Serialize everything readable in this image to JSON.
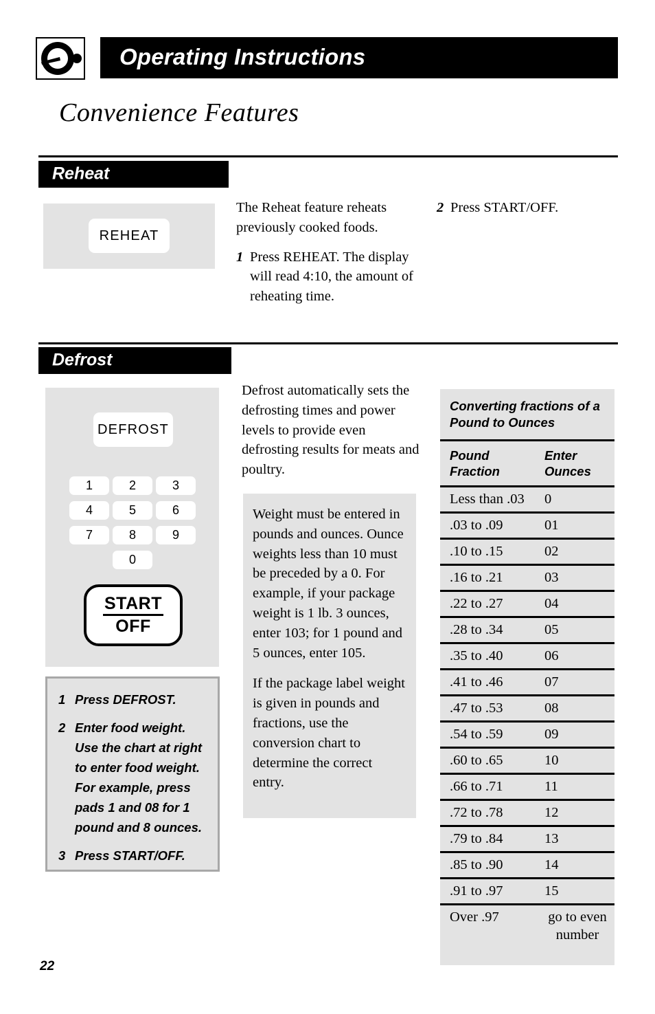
{
  "header": {
    "icon": "dial-knob-icon",
    "title": "Operating Instructions"
  },
  "page_title": "Convenience Features",
  "sections": {
    "reheat": {
      "bar_label": "Reheat",
      "panel": {
        "button_label": "REHEAT"
      },
      "intro": "The Reheat feature reheats previously cooked foods.",
      "steps": [
        {
          "num": "1",
          "text": "Press REHEAT. The display will read 4:10, the amount of reheating time."
        },
        {
          "num": "2",
          "text": "Press START/OFF."
        }
      ]
    },
    "defrost": {
      "bar_label": "Defrost",
      "panel": {
        "button_label": "DEFROST",
        "keypad": [
          "1",
          "2",
          "3",
          "4",
          "5",
          "6",
          "7",
          "8",
          "9",
          "0"
        ],
        "start_top": "START",
        "start_bottom": "OFF"
      },
      "intro": "Defrost automatically sets the defrosting times and power levels to provide even defrosting results for meats and poultry.",
      "note_paragraphs": [
        "Weight must be entered in pounds and ounces. Ounce weights less than 10 must be preceded by a 0. For example, if your package weight is 1 lb. 3 ounces, enter 103; for 1 pound and 5 ounces, enter 105.",
        "If the package label weight is given in pounds and fractions, use the conversion chart to determine the correct entry."
      ],
      "steps": [
        {
          "num": "1",
          "text": "Press DEFROST."
        },
        {
          "num": "2",
          "text": "Enter food weight. Use the chart at right to enter food weight. For example, press pads 1 and 08 for 1 pound and 8 ounces."
        },
        {
          "num": "3",
          "text": "Press START/OFF."
        }
      ]
    }
  },
  "conversion_table": {
    "title": "Converting fractions of a Pound to Ounces",
    "columns": [
      "Pound Fraction",
      "Enter Ounces"
    ],
    "column_head_left_line1": "Pound",
    "column_head_left_line2": "Fraction",
    "column_head_right_line1": "Enter",
    "column_head_right_line2": "Ounces",
    "rows": [
      {
        "fraction": "Less than .03",
        "ounces": "0"
      },
      {
        "fraction": ".03 to .09",
        "ounces": "01"
      },
      {
        "fraction": ".10 to .15",
        "ounces": "02"
      },
      {
        "fraction": ".16 to .21",
        "ounces": "03"
      },
      {
        "fraction": ".22 to .27",
        "ounces": "04"
      },
      {
        "fraction": ".28 to .34",
        "ounces": "05"
      },
      {
        "fraction": ".35 to .40",
        "ounces": "06"
      },
      {
        "fraction": ".41 to .46",
        "ounces": "07"
      },
      {
        "fraction": ".47 to .53",
        "ounces": "08"
      },
      {
        "fraction": ".54 to .59",
        "ounces": "09"
      },
      {
        "fraction": ".60 to .65",
        "ounces": "10"
      },
      {
        "fraction": ".66 to .71",
        "ounces": "11"
      },
      {
        "fraction": ".72 to .78",
        "ounces": "12"
      },
      {
        "fraction": ".79 to .84",
        "ounces": "13"
      },
      {
        "fraction": ".85 to .90",
        "ounces": "14"
      },
      {
        "fraction": ".91 to .97",
        "ounces": "15"
      },
      {
        "fraction": "Over .97",
        "ounces": "go to even number"
      }
    ]
  },
  "footer": {
    "page_number": "22"
  },
  "colors": {
    "bar_black": "#000000",
    "panel_gray": "#e3e3e3",
    "box_border_gray": "#a8a8a8",
    "page_white": "#ffffff"
  }
}
